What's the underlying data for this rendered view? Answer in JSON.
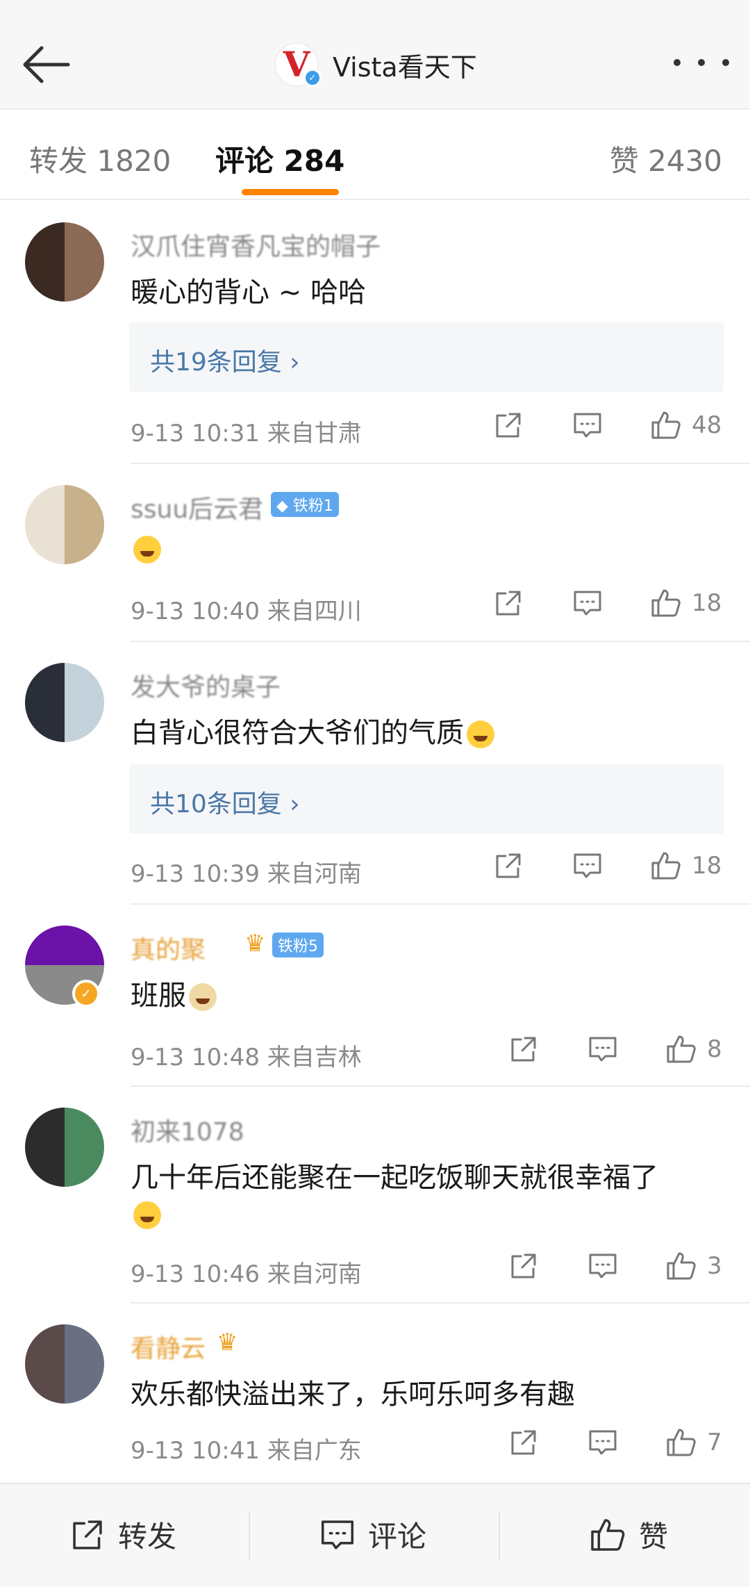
{
  "header": {
    "title": "Vista看天下",
    "logo_letter": "V"
  },
  "tabs": {
    "forward": "转发 1820",
    "comments": "评论 284",
    "likes": "赞 2430"
  },
  "comments": [
    {
      "username": "汉爪住宵香凡宝的帽子",
      "text": "暖心的背心 ~ 哈哈",
      "replies": "共19条回复 ›",
      "time_location": "9-13 10:31  来自甘肃",
      "likes": "48",
      "avatar_color_a": "#3a2a22",
      "avatar_color_b": "#8a6a55"
    },
    {
      "username": "ssuu后云君",
      "fan_badge": "◆ 铁粉1",
      "text": "",
      "time_location": "9-13 10:40  来自四川",
      "likes": "18",
      "avatar_color_a": "#e9e1d4",
      "avatar_color_b": "#c8b08a"
    },
    {
      "username": "发大爷的桌子",
      "text": "白背心很符合大爷们的气质",
      "replies": "共10条回复 ›",
      "time_location": "9-13 10:39  来自河南",
      "likes": "18",
      "avatar_color_a": "#2a2e38",
      "avatar_color_b": "#c4d2dc"
    },
    {
      "username": "真的聚",
      "fan_badge": "铁粉5",
      "text": "班服",
      "time_location": "9-13 10:48  来自吉林",
      "likes": "8",
      "avatar_color_a": "#6b12a8",
      "avatar_color_b": "#8a8a8a"
    },
    {
      "username": "初来1078",
      "text": "几十年后还能聚在一起吃饭聊天就很幸福了",
      "time_location": "9-13 10:46  来自河南",
      "likes": "3",
      "avatar_color_a": "#2c2c2c",
      "avatar_color_b": "#4b8a5e"
    },
    {
      "username": "看静云",
      "text": "欢乐都快溢出来了，乐呵乐呵多有趣",
      "time_location": "9-13 10:41  来自广东",
      "likes": "7",
      "avatar_color_a": "#5a4a4a",
      "avatar_color_b": "#6a6f82"
    }
  ],
  "bottom_bar": {
    "forward": "转发",
    "comment": "评论",
    "like": "赞"
  },
  "colors": {
    "accent": "#ff8200",
    "link": "#4a78a8",
    "fan_badge": "#5fa8f0",
    "gold_name": "#e8a23a"
  },
  "icons": [
    "back-arrow-icon",
    "more-icon",
    "share-icon",
    "comment-icon",
    "like-icon",
    "verified-icon",
    "crown-icon"
  ]
}
